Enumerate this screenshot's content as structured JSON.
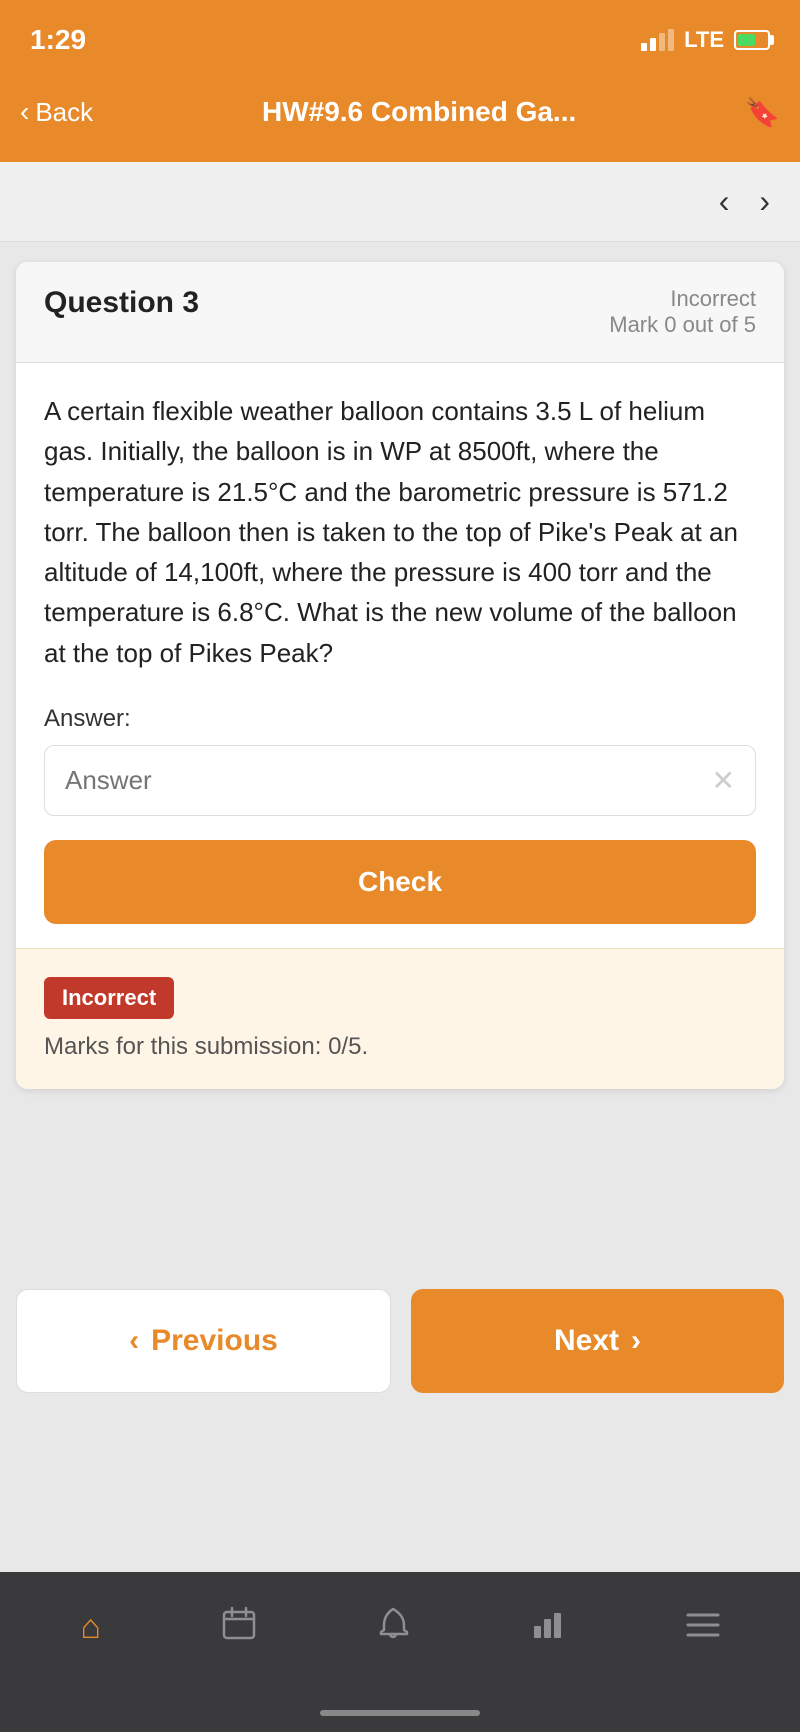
{
  "statusBar": {
    "time": "1:29",
    "lte": "LTE"
  },
  "header": {
    "backLabel": "Back",
    "title": "HW#9.6 Combined Ga..."
  },
  "navigation": {
    "prevArrow": "‹",
    "nextArrow": "›"
  },
  "question": {
    "number": "Question 3",
    "statusLabel": "Incorrect",
    "markLabel": "Mark 0 out of 5",
    "bodyText": "A certain flexible weather balloon contains 3.5 L of helium gas. Initially, the balloon is in WP at 8500ft, where the temperature is 21.5°C and the barometric pressure is 571.2 torr. The balloon then is taken to the top of Pike's Peak at an altitude of 14,100ft, where the pressure is 400 torr and the temperature is 6.8°C. What is the new volume of the balloon at the top of Pikes Peak?",
    "answerLabel": "Answer:",
    "answerPlaceholder": "Answer",
    "checkButton": "Check"
  },
  "feedback": {
    "badge": "Incorrect",
    "text": "Marks for this submission: 0/5."
  },
  "navButtons": {
    "previous": "Previous",
    "next": "Next"
  },
  "tabBar": {
    "items": [
      "home",
      "calendar",
      "bell",
      "chart",
      "menu"
    ]
  }
}
